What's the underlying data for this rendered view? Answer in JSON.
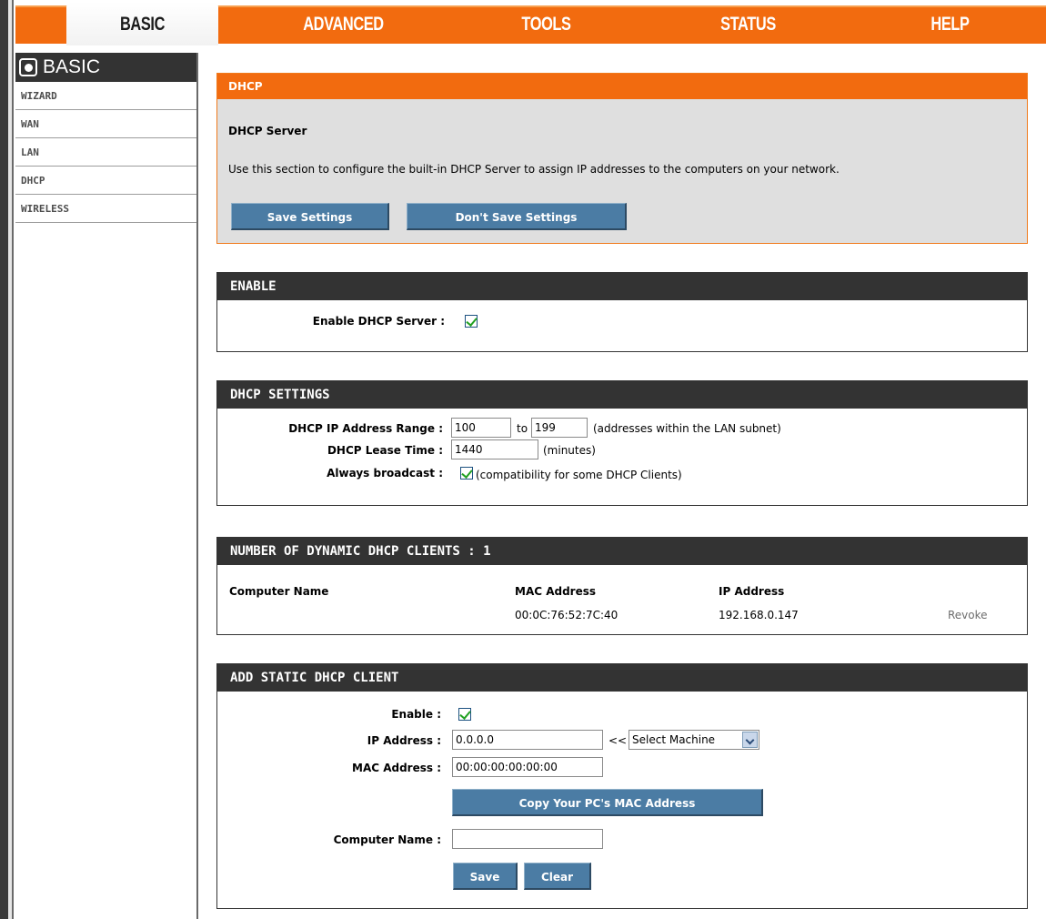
{
  "nav": {
    "tabs": [
      {
        "label": "BASIC"
      },
      {
        "label": "ADVANCED"
      },
      {
        "label": "TOOLS"
      },
      {
        "label": "STATUS"
      },
      {
        "label": "HELP"
      }
    ],
    "active": "BASIC"
  },
  "sidebar": {
    "title": "BASIC",
    "icon": "basic-icon",
    "items": [
      {
        "label": "WIZARD"
      },
      {
        "label": "WAN"
      },
      {
        "label": "LAN"
      },
      {
        "label": "DHCP"
      },
      {
        "label": "WIRELESS"
      }
    ]
  },
  "dhcp": {
    "title": "DHCP",
    "subtitle": "DHCP Server",
    "description": "Use this section to configure the built-in DHCP Server to assign IP addresses to the computers on your network.",
    "save_label": "Save Settings",
    "dont_save_label": "Don't Save Settings"
  },
  "enable": {
    "title": "ENABLE",
    "enable_label": "Enable DHCP Server :",
    "enabled": true
  },
  "settings": {
    "title": "DHCP SETTINGS",
    "range_label": "DHCP IP Address Range :",
    "range_start": "100",
    "range_to": "to",
    "range_end": "199",
    "range_note": "(addresses within the LAN subnet)",
    "lease_label": "DHCP Lease Time :",
    "lease_value": "1440",
    "lease_unit": "(minutes)",
    "broadcast_label": "Always broadcast :",
    "broadcast_checked": true,
    "broadcast_note": "(compatibility for some DHCP Clients)"
  },
  "clients": {
    "title": "NUMBER OF DYNAMIC DHCP CLIENTS : 1",
    "headers": {
      "name": "Computer Name",
      "mac": "MAC Address",
      "ip": "IP Address"
    },
    "rows": [
      {
        "name": "",
        "mac": "00:0C:76:52:7C:40",
        "ip": "192.168.0.147",
        "action": "Revoke"
      }
    ]
  },
  "static": {
    "title": "ADD STATIC DHCP CLIENT",
    "enable_label": "Enable :",
    "enable_checked": true,
    "ip_label": "IP Address :",
    "ip_value": "0.0.0.0",
    "arrow_text": "<<",
    "select_value": "Select Machine",
    "mac_label": "MAC Address :",
    "mac_value": "00:00:00:00:00:00",
    "copy_mac_label": "Copy Your PC's MAC Address",
    "name_label": "Computer Name :",
    "name_value": "",
    "save_label": "Save",
    "clear_label": "Clear"
  },
  "colors": {
    "orange": "#f26b0f",
    "dark_header": "#333333",
    "button_blue": "#4b7ca4",
    "panel_gray": "#dfdfdf"
  }
}
